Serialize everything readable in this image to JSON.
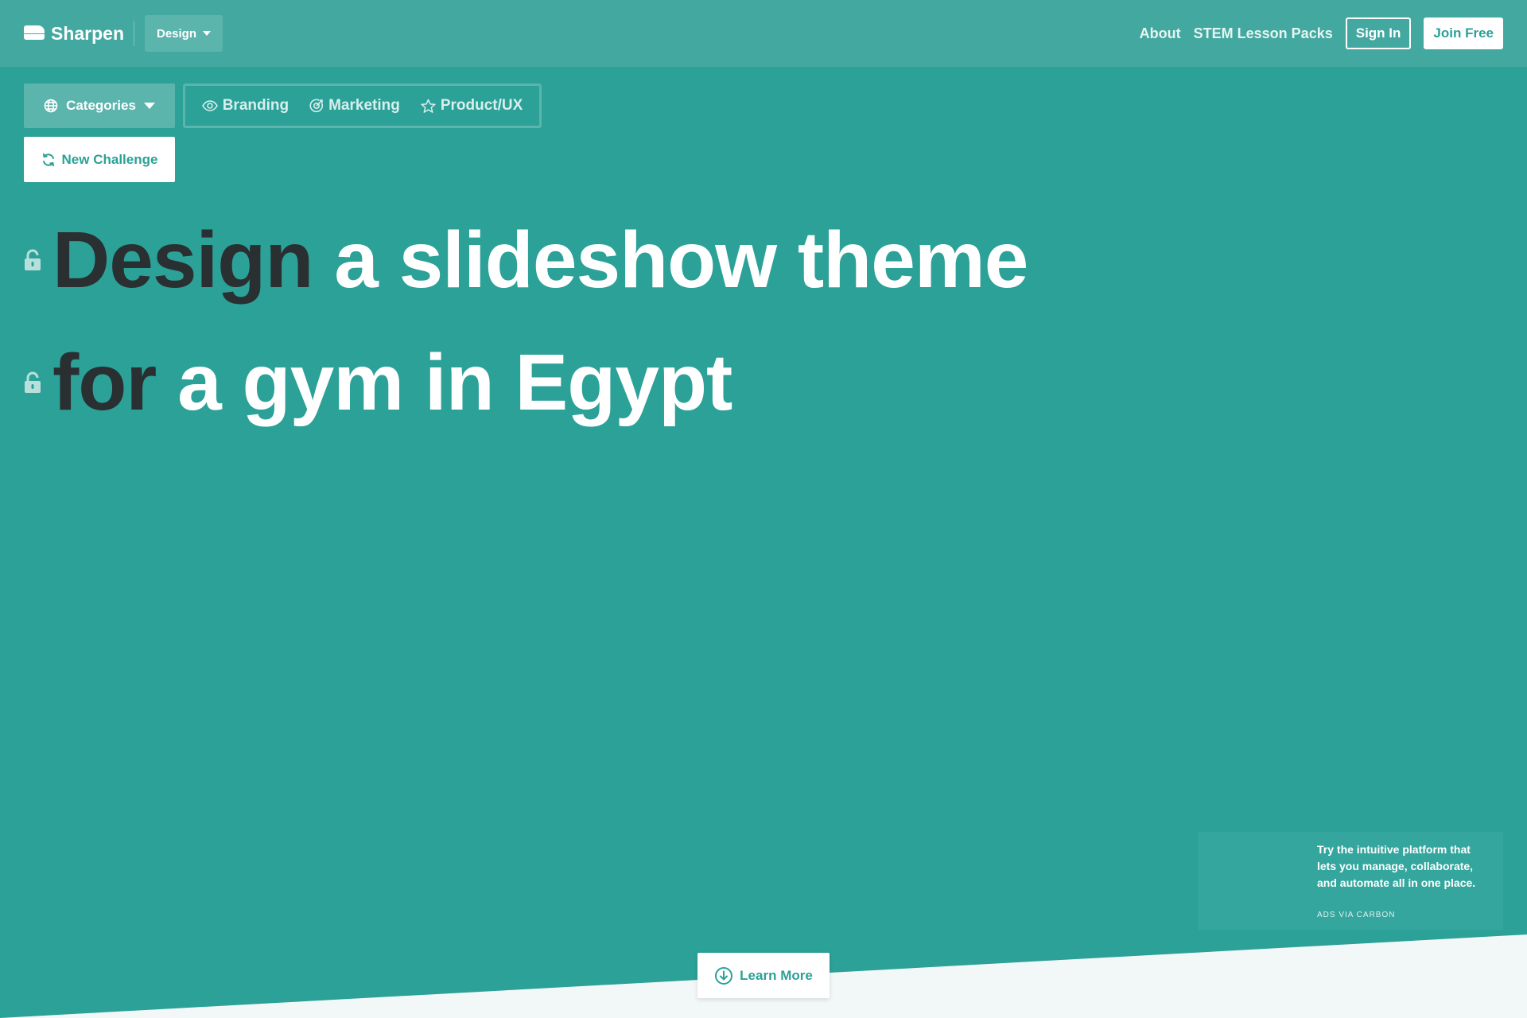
{
  "header": {
    "logo_text": "Sharpen",
    "mode_dropdown": "Design",
    "links": [
      "About",
      "STEM Lesson Packs"
    ],
    "sign_in": "Sign In",
    "join_free": "Join Free"
  },
  "categories": {
    "dropdown_label": "Categories",
    "items": [
      {
        "label": "Branding",
        "icon": "eye-icon"
      },
      {
        "label": "Marketing",
        "icon": "target-icon"
      },
      {
        "label": "Product/UX",
        "icon": "star-icon"
      }
    ]
  },
  "new_challenge": "New Challenge",
  "prompt": {
    "line1": {
      "dark": "Design",
      "light": "a slideshow theme"
    },
    "line2": {
      "dark": "for",
      "light": "a gym in Egypt"
    }
  },
  "ad": {
    "text": "Try the intuitive platform that lets you manage, collaborate, and automate all in one place.",
    "label": "ADS VIA CARBON"
  },
  "learn_more": "Learn More",
  "colors": {
    "background": "#2ba198",
    "header": "#43a9a0",
    "button_tint": "#5cb5ad",
    "dark_text": "#2a2f31",
    "bottom_panel": "#f2f8f8"
  }
}
